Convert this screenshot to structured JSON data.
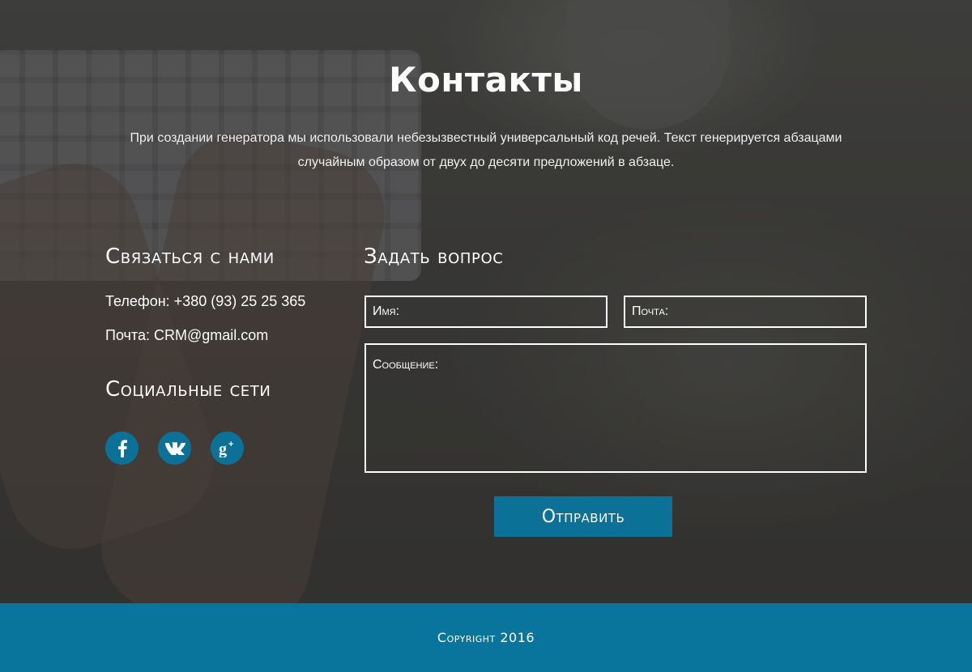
{
  "page": {
    "title": "Контакты",
    "intro": "При создании генератора мы использовали небезызвестный универсальный код речей. Текст генерируется абзацами случайным образом от двух до десяти предложений в абзаце."
  },
  "contact": {
    "heading": "Связаться с нами",
    "phone": "Телефон: +380 (93) 25 25 365",
    "email": "Почта: CRM@gmail.com"
  },
  "social": {
    "heading": "Социальные сети",
    "items": [
      {
        "name": "facebook",
        "icon": "facebook-icon",
        "glyph": "f"
      },
      {
        "name": "vk",
        "icon": "vk-icon",
        "glyph": "vk"
      },
      {
        "name": "google-plus",
        "icon": "google-plus-icon",
        "glyph": "g+"
      }
    ]
  },
  "form": {
    "heading": "Задать вопрос",
    "name_placeholder": "Имя:",
    "email_placeholder": "Почта:",
    "message_placeholder": "Сообщение:",
    "submit_label": "Отправить"
  },
  "footer": {
    "copyright": "Copyright 2016"
  },
  "colors": {
    "accent": "#0c7197",
    "footer": "#0a759c",
    "text": "#ffffff"
  }
}
